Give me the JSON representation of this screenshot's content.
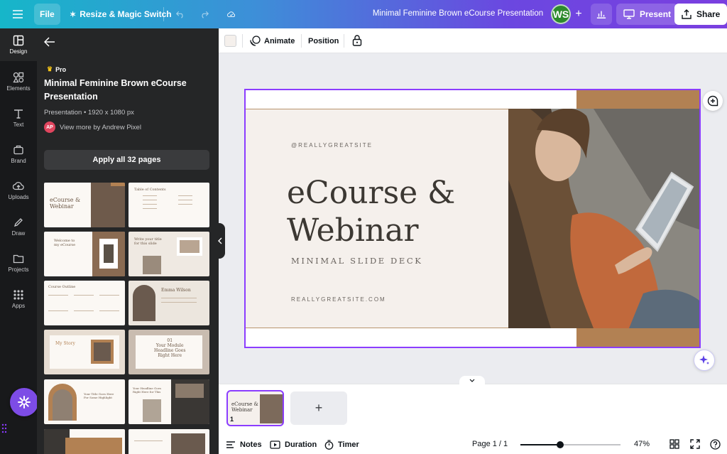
{
  "topbar": {
    "file_label": "File",
    "resize_label": "Resize & Magic Switch",
    "doc_title": "Minimal Feminine Brown eCourse Presentation",
    "user_initials": "WS",
    "present_label": "Present",
    "share_label": "Share"
  },
  "rail": {
    "items": [
      {
        "label": "Design",
        "icon": "design-icon"
      },
      {
        "label": "Elements",
        "icon": "elements-icon"
      },
      {
        "label": "Text",
        "icon": "text-icon"
      },
      {
        "label": "Brand",
        "icon": "brand-icon"
      },
      {
        "label": "Uploads",
        "icon": "uploads-icon"
      },
      {
        "label": "Draw",
        "icon": "draw-icon"
      },
      {
        "label": "Projects",
        "icon": "projects-icon"
      },
      {
        "label": "Apps",
        "icon": "apps-icon"
      }
    ]
  },
  "panel": {
    "pro_label": "Pro",
    "template_title": "Minimal Feminine Brown eCourse Presentation",
    "template_meta": "Presentation • 1920 x 1080 px",
    "author_initials": "AP",
    "author_link": "View more by Andrew Pixel",
    "apply_label": "Apply all 32 pages",
    "thumbnails": [
      {
        "text": "eCourse &\nWebinar"
      },
      {
        "text": "Table of Contents"
      },
      {
        "text": "Welcome to\nmy eCourse"
      },
      {
        "text": "Write your title\nfor this slide"
      },
      {
        "text": "Course Outline"
      },
      {
        "text": "Emma Wilson"
      },
      {
        "text": "My Story"
      },
      {
        "text": "01\nYour Module\nHeadline Goes\nRight Here"
      },
      {
        "text": "Your Title Goes Here\nFor Some Highlight"
      },
      {
        "text": "Your Headline Goes\nRight Here for This"
      }
    ]
  },
  "context_toolbar": {
    "animate_label": "Animate",
    "position_label": "Position"
  },
  "slide": {
    "handle": "@REALLYGREATSITE",
    "title_line1": "eCourse &",
    "title_line2": "Webinar",
    "subtitle": "MINIMAL SLIDE DECK",
    "website": "REALLYGREATSITE.COM"
  },
  "pages": {
    "thumb_text": "eCourse &\nWebinar",
    "thumb_number": "1",
    "add_symbol": "+"
  },
  "footer": {
    "notes_label": "Notes",
    "duration_label": "Duration",
    "timer_label": "Timer",
    "page_indicator": "Page 1 / 1",
    "zoom_label": "47%",
    "zoom_fraction": 0.4
  },
  "colors": {
    "accent_purple": "#8b3dff",
    "slide_background": "#f5f0ec",
    "slide_brown": "#b28153",
    "panel_dark": "#252627"
  }
}
